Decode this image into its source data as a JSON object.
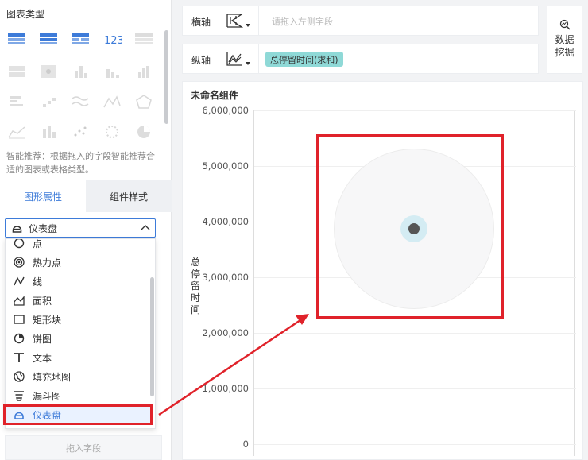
{
  "left_panel": {
    "chart_type_title": "图表类型",
    "smart_tip": "智能推荐：根据拖入的字段智能推荐合适的图表或表格类型。",
    "tabs": [
      {
        "label": "图形属性",
        "active": true
      },
      {
        "label": "组件样式",
        "active": false
      }
    ],
    "selected_type": "仪表盘",
    "dropdown_items": [
      {
        "label": "点",
        "icon": "circle-outline-icon"
      },
      {
        "label": "热力点",
        "icon": "heat-point-icon"
      },
      {
        "label": "线",
        "icon": "line-icon"
      },
      {
        "label": "面积",
        "icon": "area-icon"
      },
      {
        "label": "矩形块",
        "icon": "rectangle-icon"
      },
      {
        "label": "饼图",
        "icon": "pie-icon"
      },
      {
        "label": "文本",
        "icon": "text-icon"
      },
      {
        "label": "填充地图",
        "icon": "globe-icon"
      },
      {
        "label": "漏斗图",
        "icon": "funnel-icon"
      },
      {
        "label": "仪表盘",
        "icon": "gauge-icon"
      }
    ],
    "drop_field_label": "拖入字段"
  },
  "x_axis": {
    "label": "横轴",
    "placeholder": "请拖入左侧字段"
  },
  "y_axis": {
    "label": "纵轴",
    "field": "总停留时间(求和)"
  },
  "mining_button": {
    "line1": "数据",
    "line2": "挖掘"
  },
  "component": {
    "title": "未命名组件"
  },
  "chart_data": {
    "type": "gauge",
    "ylabel": "总停留时间",
    "y_ticks": [
      "6,000,000",
      "5,000,000",
      "4,000,000",
      "3,000,000",
      "2,000,000",
      "1,000,000",
      "0"
    ],
    "ylim": [
      0,
      6000000
    ]
  },
  "colors": {
    "accent": "#3d7bd9",
    "highlight": "#e0222a",
    "field_tag": "#8fd9d7"
  }
}
